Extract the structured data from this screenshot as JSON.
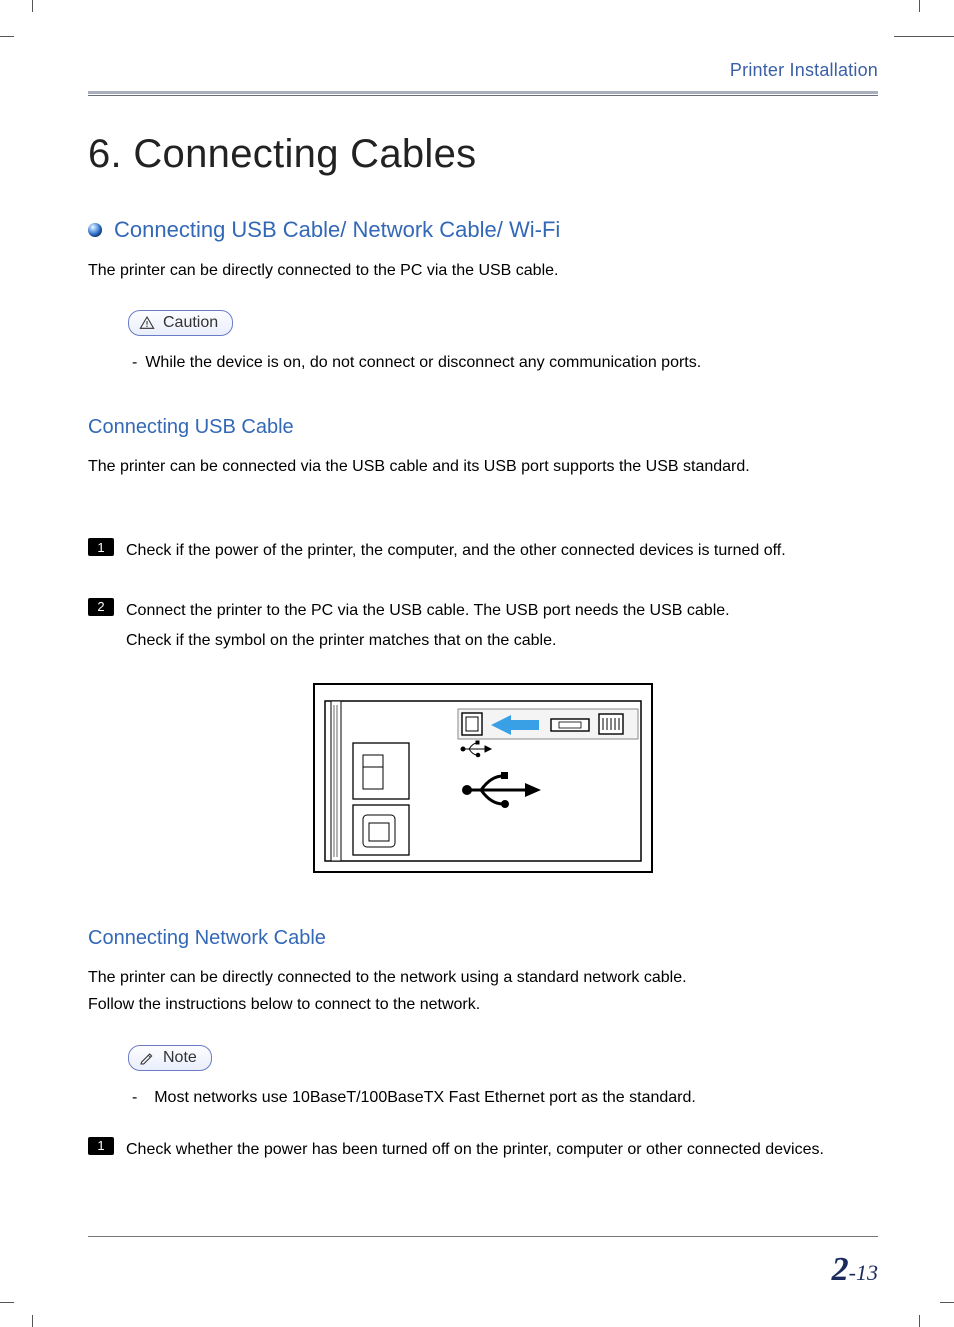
{
  "header": {
    "section_label": "Printer Installation"
  },
  "chapter": {
    "title": "6. Connecting Cables"
  },
  "section_main": {
    "title": "Connecting USB Cable/ Network Cable/ Wi-Fi",
    "intro": "The printer can be directly connected to the PC via the USB cable."
  },
  "caution": {
    "label": "Caution",
    "items": [
      "While the device is on, do not connect or disconnect any communication ports."
    ]
  },
  "usb": {
    "title": "Connecting USB Cable",
    "intro": "The printer can be connected via the USB cable and its USB port supports the USB standard.",
    "steps": [
      "Check if the power of the printer, the computer, and the other connected devices is turned off.",
      "Connect the printer to the PC via the USB cable. The USB port needs the USB cable.\nCheck if the symbol on the printer matches that on the cable."
    ]
  },
  "network": {
    "title": "Connecting Network Cable",
    "intro": "The printer can be directly connected to the network using a standard network cable.\nFollow the instructions below to connect to the network.",
    "note_label": "Note",
    "note_items": [
      "Most networks use 10BaseT/100BaseTX Fast Ethernet port as the standard."
    ],
    "steps": [
      "Check whether the power has been turned off on the printer, computer or other connected devices."
    ]
  },
  "page": {
    "chapter_num": "2",
    "page_num": "-13"
  }
}
